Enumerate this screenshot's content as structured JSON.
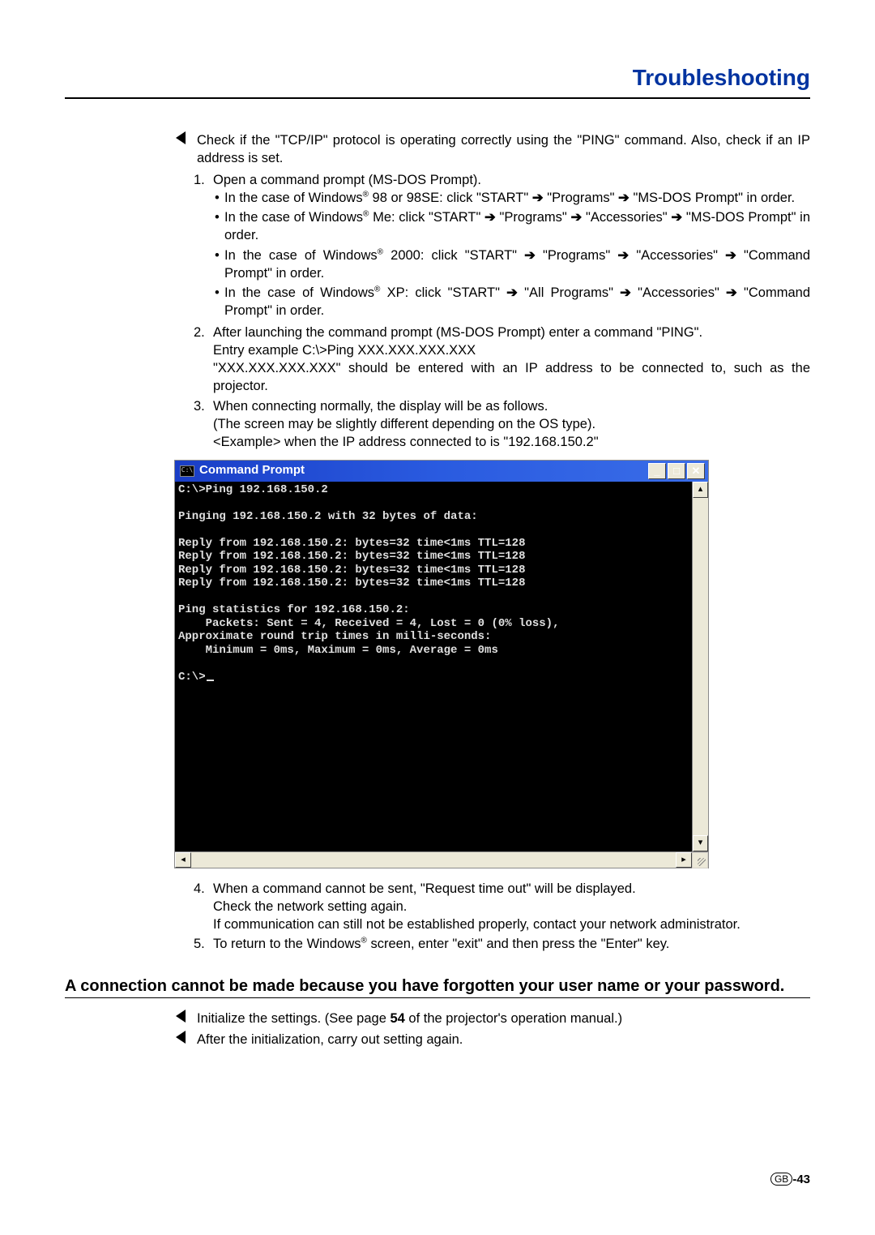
{
  "title": "Troubleshooting",
  "intro": "Check if the \"TCP/IP\" protocol is operating correctly using the \"PING\" command. Also, check if an IP address is set.",
  "step1": {
    "num": "1.",
    "text": "Open a command prompt (MS-DOS Prompt).",
    "bullets": [
      {
        "pre": "In the case of Windows",
        "reg": "®",
        "post": " 98 or 98SE: click \"START\" ",
        "arrow": "➔",
        "rest1": " \"Programs\" ",
        "rest2": " \"MS-DOS Prompt\" in order."
      },
      {
        "pre": "In the case of Windows",
        "reg": "®",
        "post": " Me: click \"START\" ",
        "arrow": "➔",
        "rest1": " \"Programs\" ",
        "rest2": " \"Accessories\" ",
        "rest3": " \"MS-DOS Prompt\" in order."
      },
      {
        "pre": "In the case of Windows",
        "reg": "®",
        "post": " 2000: click \"START\" ",
        "arrow": "➔",
        "rest1": " \"Programs\" ",
        "rest2": " \"Accessories\" ",
        "rest3": " \"Command Prompt\" in order."
      },
      {
        "pre": "In the case of Windows",
        "reg": "®",
        "post": " XP: click \"START\" ",
        "arrow": "➔",
        "rest1": " \"All Programs\" ",
        "rest2": " \"Accessories\" ",
        "rest3": " \"Command Prompt\" in order."
      }
    ]
  },
  "step2": {
    "num": "2.",
    "line1": "After launching the command prompt (MS-DOS Prompt) enter a command \"PING\".",
    "line2": "Entry example C:\\>Ping XXX.XXX.XXX.XXX",
    "line3": "\"XXX.XXX.XXX.XXX\" should be entered with an IP address to be connected to, such as the projector."
  },
  "step3": {
    "num": "3.",
    "line1": "When connecting normally, the display will be as follows.",
    "line2": "(The screen may be slightly different depending on the OS type).",
    "line3": "<Example> when the IP address connected to is \"192.168.150.2\""
  },
  "cmd": {
    "title": "Command Prompt",
    "icon_text": "C:\\",
    "lines": "C:\\>Ping 192.168.150.2\n\nPinging 192.168.150.2 with 32 bytes of data:\n\nReply from 192.168.150.2: bytes=32 time<1ms TTL=128\nReply from 192.168.150.2: bytes=32 time<1ms TTL=128\nReply from 192.168.150.2: bytes=32 time<1ms TTL=128\nReply from 192.168.150.2: bytes=32 time<1ms TTL=128\n\nPing statistics for 192.168.150.2:\n    Packets: Sent = 4, Received = 4, Lost = 0 (0% loss),\nApproximate round trip times in milli-seconds:\n    Minimum = 0ms, Maximum = 0ms, Average = 0ms\n\nC:\\>",
    "buttons": {
      "min": "_",
      "max": "□",
      "close": "✕"
    },
    "scroll": {
      "up": "▴",
      "down": "▾",
      "left": "◂",
      "right": "▸"
    }
  },
  "step4": {
    "num": "4.",
    "line1": "When a command cannot be sent, \"Request time out\" will be displayed.",
    "line2": "Check the network setting again.",
    "line3": "If communication can still not be established properly, contact your network administrator."
  },
  "step5": {
    "num": "5.",
    "pre": "To return to the Windows",
    "reg": "®",
    "post": " screen, enter \"exit\" and then press the \"Enter\" key."
  },
  "section2": {
    "heading": "A connection cannot be made because you have forgotten your user name or your password.",
    "b1_pre": "Initialize the settings. (See page ",
    "b1_bold": "54",
    "b1_post": " of the projector's operation manual.)",
    "b2": "After the initialization, carry out setting again."
  },
  "footer": {
    "gb": "GB",
    "sep": "-",
    "page": "43"
  }
}
